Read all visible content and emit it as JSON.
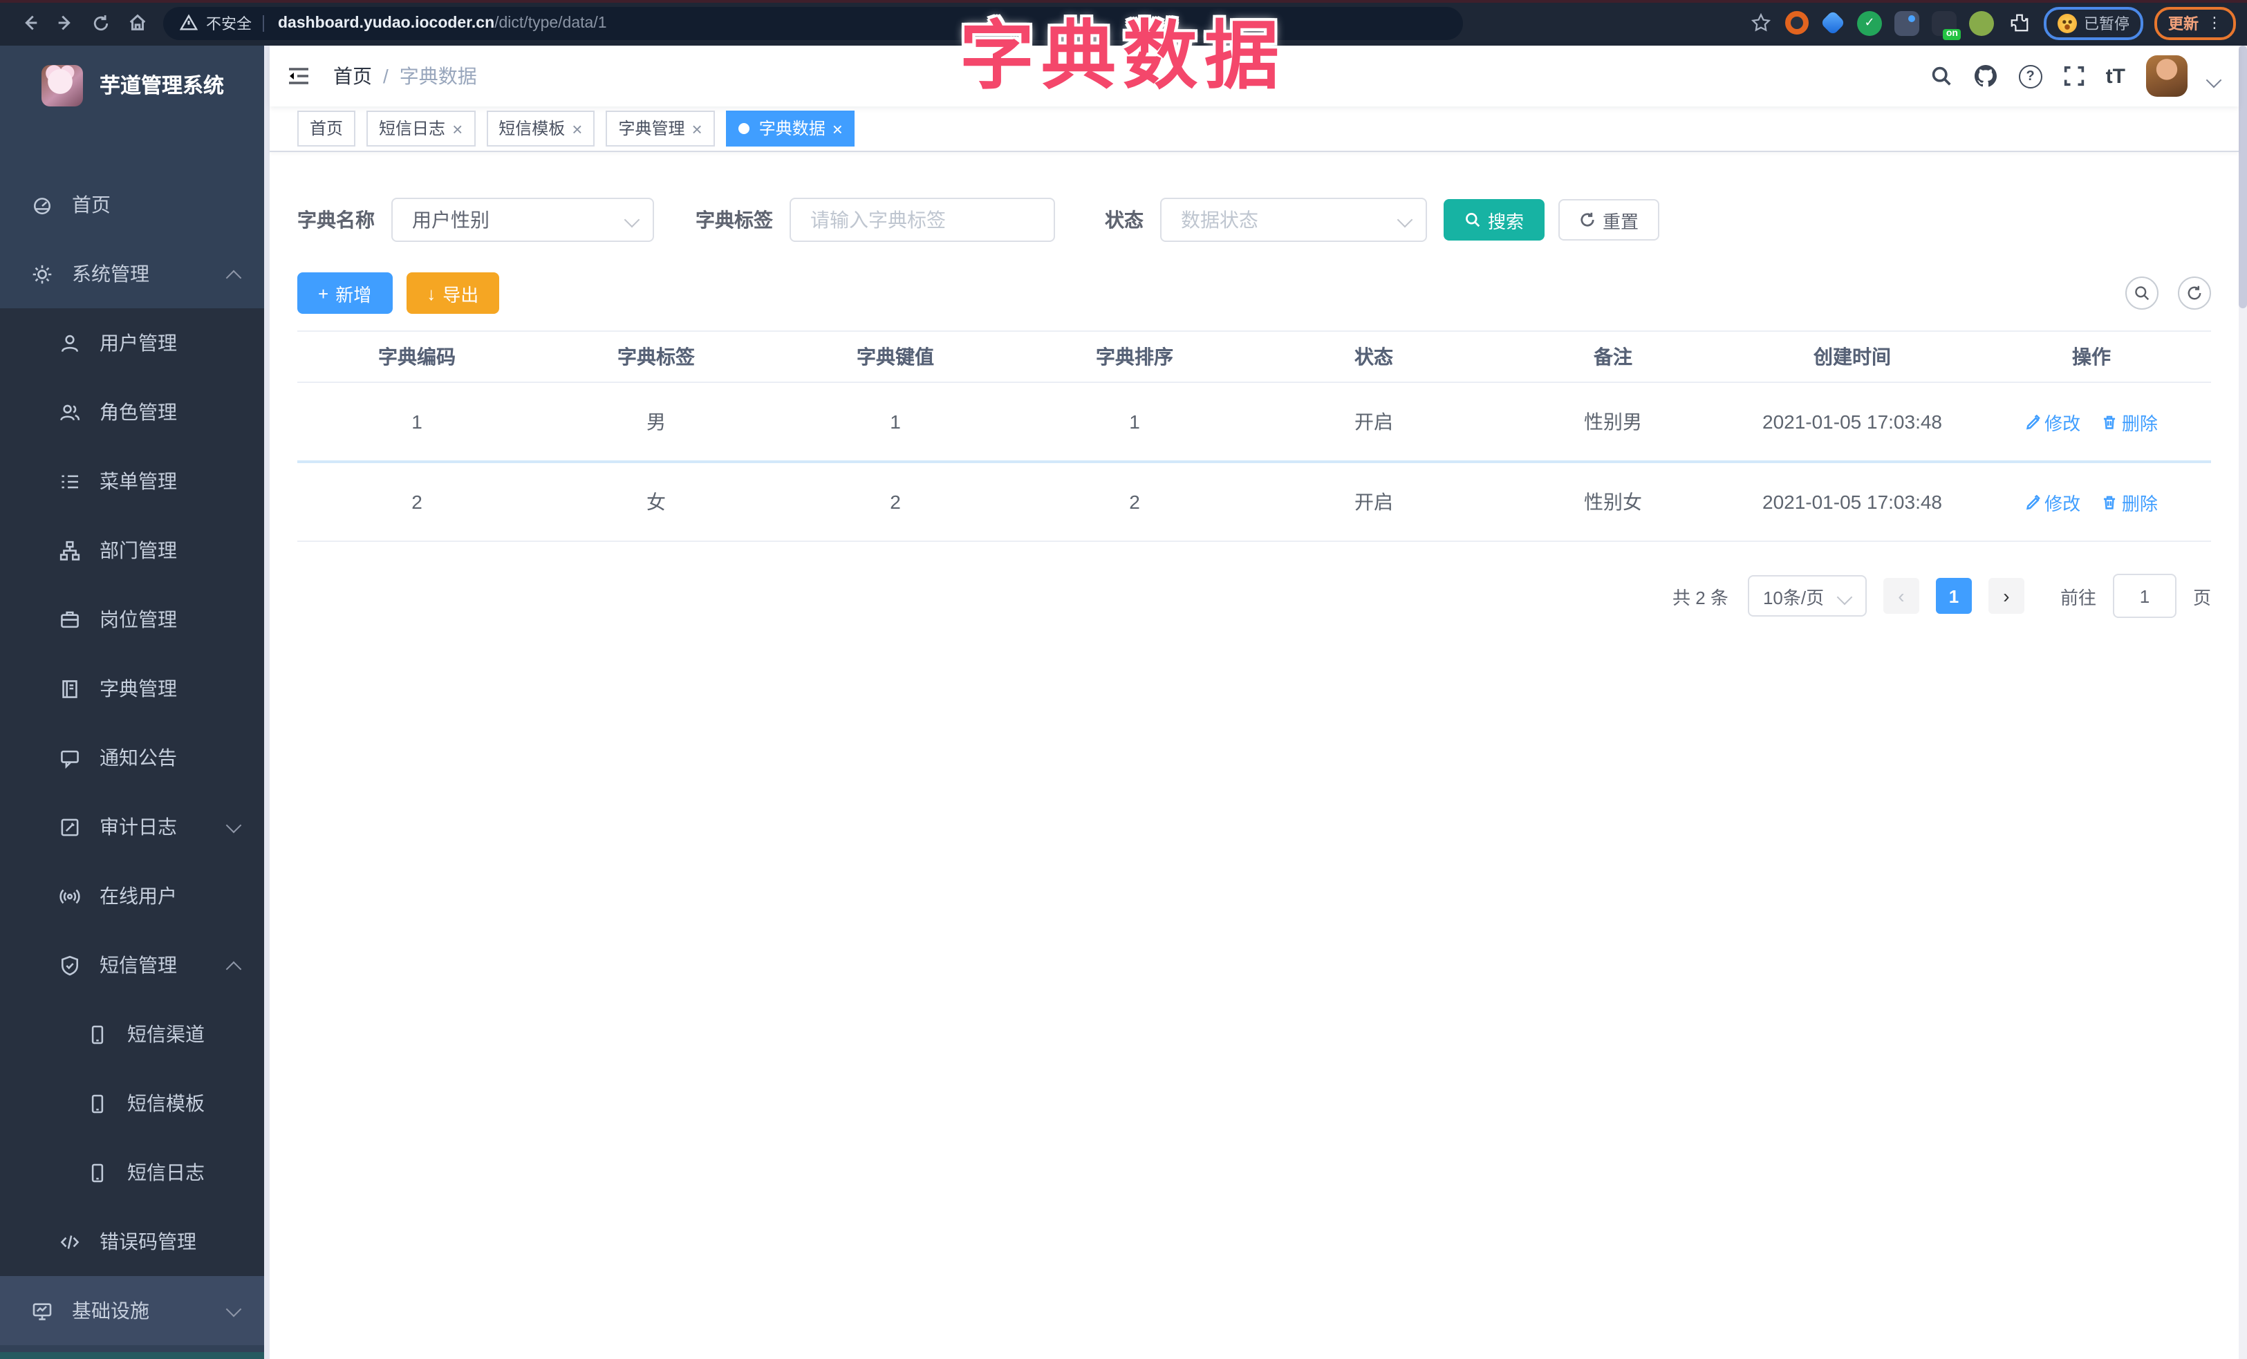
{
  "overlay": {
    "title": "字典数据",
    "color": "#f4476b"
  },
  "browser": {
    "security_label": "不安全",
    "url_host": "dashboard.yudao.iocoder.cn",
    "url_path": "/dict/type/data/1",
    "paused_label": "已暂停",
    "update_label": "更新",
    "on_badge": "on"
  },
  "icons": {
    "close": "×",
    "plus": "+",
    "download": "↓",
    "question": "?",
    "font_size": "tT",
    "more": "⋮",
    "prev": "‹",
    "next": "›",
    "check": "✓"
  },
  "sidebar": {
    "title": "芋道管理系统",
    "items": [
      {
        "label": "首页",
        "icon": "dashboard-icon",
        "level": 0
      },
      {
        "label": "系统管理",
        "icon": "gear-icon",
        "level": 0,
        "caret": "up"
      },
      {
        "label": "用户管理",
        "icon": "user-icon",
        "level": 1
      },
      {
        "label": "角色管理",
        "icon": "users-icon",
        "level": 1
      },
      {
        "label": "菜单管理",
        "icon": "menu-icon",
        "level": 1
      },
      {
        "label": "部门管理",
        "icon": "tree-icon",
        "level": 1
      },
      {
        "label": "岗位管理",
        "icon": "briefcase-icon",
        "level": 1
      },
      {
        "label": "字典管理",
        "icon": "book-icon",
        "level": 1
      },
      {
        "label": "通知公告",
        "icon": "message-icon",
        "level": 1
      },
      {
        "label": "审计日志",
        "icon": "edit-icon",
        "level": 1,
        "caret": "down"
      },
      {
        "label": "在线用户",
        "icon": "online-icon",
        "level": 1
      },
      {
        "label": "短信管理",
        "icon": "shield-icon",
        "level": 1,
        "caret": "up"
      },
      {
        "label": "短信渠道",
        "icon": "phone-icon",
        "level": 2
      },
      {
        "label": "短信模板",
        "icon": "phone-icon",
        "level": 2
      },
      {
        "label": "短信日志",
        "icon": "phone-icon",
        "level": 2
      },
      {
        "label": "错误码管理",
        "icon": "code-icon",
        "level": 1
      },
      {
        "label": "基础设施",
        "icon": "monitor-icon",
        "level": 0,
        "caret": "down"
      }
    ]
  },
  "navbar": {
    "breadcrumb_home": "首页",
    "breadcrumb_sep": "/",
    "breadcrumb_current": "字典数据"
  },
  "tags": [
    {
      "label": "首页"
    },
    {
      "label": "短信日志"
    },
    {
      "label": "短信模板"
    },
    {
      "label": "字典管理"
    },
    {
      "label": "字典数据"
    }
  ],
  "filters": {
    "name_label": "字典名称",
    "name_value": "用户性别",
    "tag_label": "字典标签",
    "tag_placeholder": "请输入字典标签",
    "status_label": "状态",
    "status_placeholder": "数据状态",
    "search_label": "搜索",
    "reset_label": "重置"
  },
  "toolbar": {
    "add_label": "新增",
    "export_label": "导出"
  },
  "table": {
    "columns": [
      "字典编码",
      "字典标签",
      "字典键值",
      "字典排序",
      "状态",
      "备注",
      "创建时间",
      "操作"
    ],
    "rows": [
      {
        "code": "1",
        "label": "男",
        "value": "1",
        "sort": "1",
        "status": "开启",
        "remark": "性别男",
        "created": "2021-01-05 17:03:48"
      },
      {
        "code": "2",
        "label": "女",
        "value": "2",
        "sort": "2",
        "status": "开启",
        "remark": "性别女",
        "created": "2021-01-05 17:03:48"
      }
    ],
    "actions": {
      "edit": "修改",
      "delete": "删除"
    }
  },
  "pagination": {
    "total_text": "共 2 条",
    "page_size": "10条/页",
    "current_page": "1",
    "goto_label": "前往",
    "goto_value": "1",
    "page_unit": "页"
  }
}
